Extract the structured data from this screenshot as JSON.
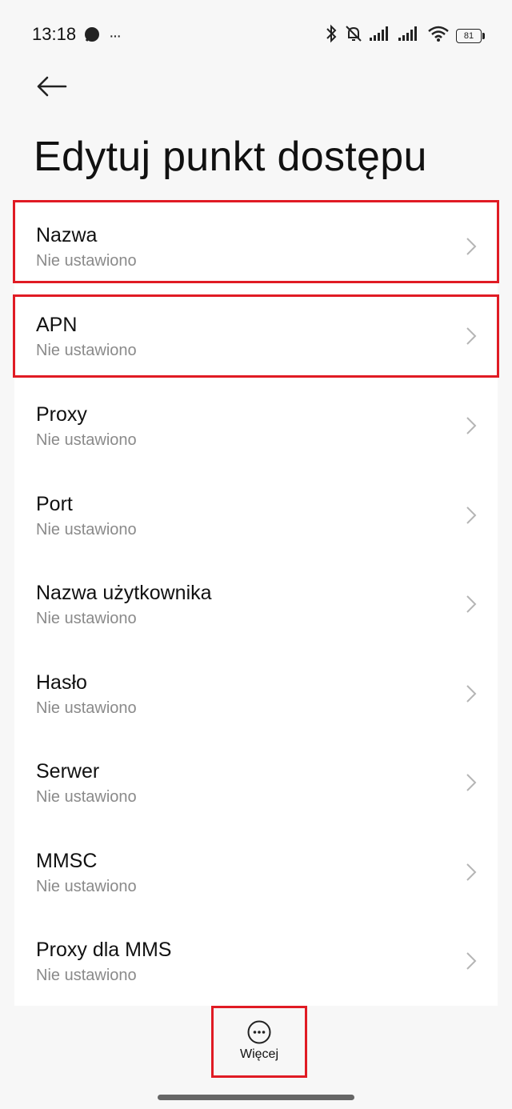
{
  "status_bar": {
    "time": "13:18",
    "overflow": "···",
    "battery_level": "81",
    "icons": [
      "message-bubble-icon",
      "bluetooth-icon",
      "bell-muted-icon",
      "signal-icon",
      "signal-icon",
      "wifi-icon",
      "battery-icon"
    ]
  },
  "header": {
    "back_icon": "arrow-left-icon",
    "title": "Edytuj punkt dostępu"
  },
  "settings": {
    "items": [
      {
        "title": "Nazwa",
        "value": "Nie ustawiono",
        "highlighted": true
      },
      {
        "title": "APN",
        "value": "Nie ustawiono",
        "highlighted": true
      },
      {
        "title": "Proxy",
        "value": "Nie ustawiono",
        "highlighted": false
      },
      {
        "title": "Port",
        "value": "Nie ustawiono",
        "highlighted": false
      },
      {
        "title": "Nazwa użytkownika",
        "value": "Nie ustawiono",
        "highlighted": false
      },
      {
        "title": "Hasło",
        "value": "Nie ustawiono",
        "highlighted": false
      },
      {
        "title": "Serwer",
        "value": "Nie ustawiono",
        "highlighted": false
      },
      {
        "title": "MMSC",
        "value": "Nie ustawiono",
        "highlighted": false
      },
      {
        "title": "Proxy dla MMS",
        "value": "Nie ustawiono",
        "highlighted": false
      }
    ]
  },
  "bottom": {
    "more_label": "Więcej",
    "more_icon": "more-dots-icon"
  },
  "colors": {
    "highlight": "#e01b24",
    "background": "#f7f7f7",
    "secondary_text": "#8a8a8a"
  }
}
